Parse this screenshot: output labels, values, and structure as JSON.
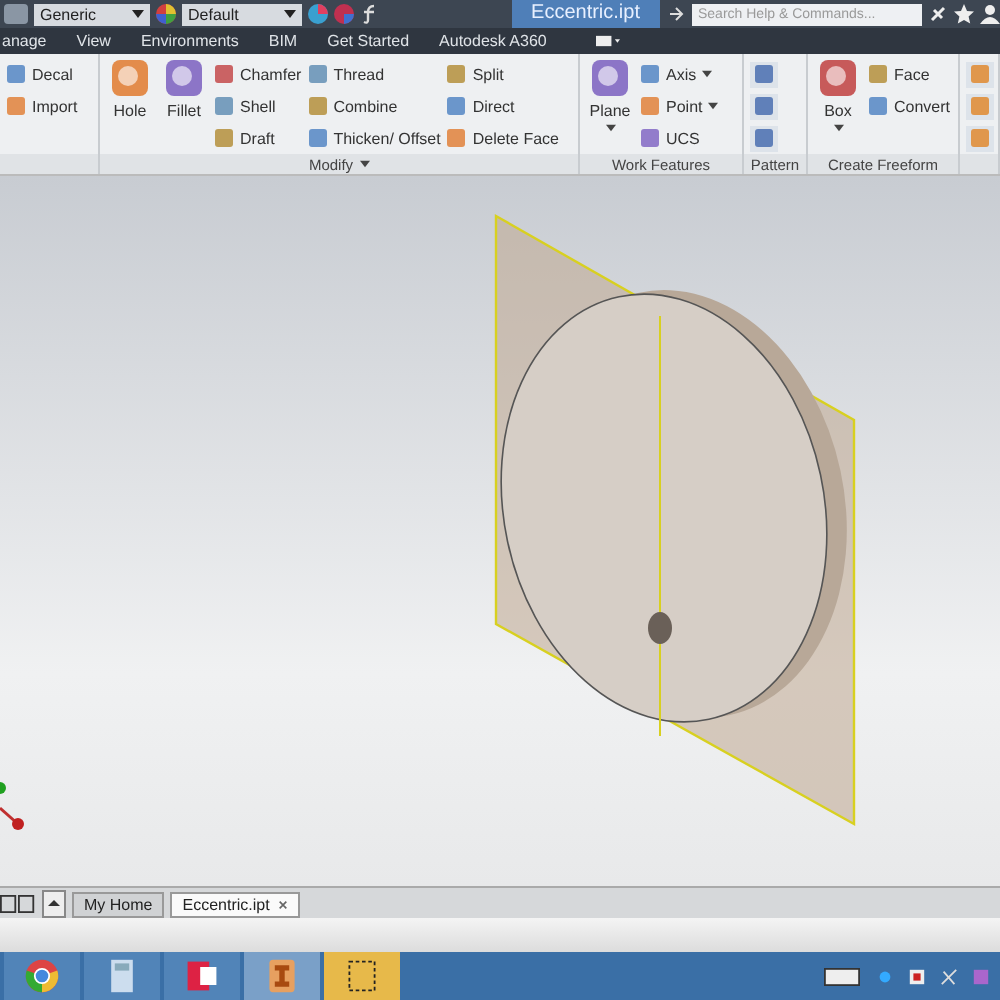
{
  "title_bar": {
    "material": "Generic",
    "appearance": "Default",
    "title": "Eccentric.ipt",
    "search": {
      "placeholder": "Search Help & Commands..."
    }
  },
  "menu_tabs": [
    {
      "label": "anage"
    },
    {
      "label": "View"
    },
    {
      "label": "Environments"
    },
    {
      "label": "BIM"
    },
    {
      "label": "Get Started"
    },
    {
      "label": "Autodesk A360"
    }
  ],
  "ribbon": {
    "panels": [
      {
        "groups": [
          {
            "kind": "small",
            "items": [
              "Decal",
              "Import"
            ]
          }
        ]
      },
      {
        "title": "Modify",
        "dropdown": true,
        "groups": [
          {
            "kind": "large",
            "items": [
              "Hole",
              "Fillet"
            ]
          },
          {
            "kind": "small",
            "items": [
              "Chamfer",
              "Shell",
              "Draft"
            ]
          },
          {
            "kind": "small",
            "items": [
              "Thread",
              "Combine",
              "Thicken/ Offset"
            ]
          },
          {
            "kind": "small",
            "items": [
              "Split",
              "Direct",
              "Delete Face"
            ]
          }
        ]
      },
      {
        "title": "Work Features",
        "groups": [
          {
            "kind": "large",
            "items": [
              "Plane"
            ]
          },
          {
            "kind": "small",
            "items": [
              "Axis",
              "Point",
              "UCS"
            ]
          }
        ]
      },
      {
        "title": "Pattern",
        "groups": [
          {
            "kind": "icons"
          }
        ]
      },
      {
        "title": "Create Freeform",
        "groups": [
          {
            "kind": "large",
            "items": [
              "Box"
            ]
          },
          {
            "kind": "small",
            "items": [
              "Face",
              "Convert"
            ]
          }
        ]
      },
      {
        "groups": [
          {
            "kind": "icons"
          }
        ]
      }
    ]
  },
  "doc_tabs": [
    {
      "label": "My Home",
      "selected": false
    },
    {
      "label": "Eccentric.ipt",
      "selected": true
    }
  ]
}
